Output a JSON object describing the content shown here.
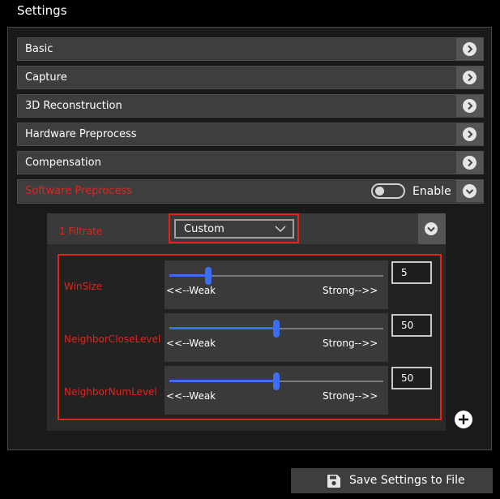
{
  "window": {
    "title": "Settings"
  },
  "sections": [
    {
      "label": "Basic"
    },
    {
      "label": "Capture"
    },
    {
      "label": "3D Reconstruction"
    },
    {
      "label": "Hardware Preprocess"
    },
    {
      "label": "Compensation"
    },
    {
      "label": "Software Preprocess"
    }
  ],
  "software_preprocess": {
    "enable_label": "Enable",
    "enable_on": false,
    "filter": {
      "name": "1  Filtrate",
      "mode": "Custom",
      "params": [
        {
          "label": "WinSize",
          "weak": "<<--Weak",
          "strong": "Strong-->>",
          "value": "5",
          "level": 0.18
        },
        {
          "label": "NeighborCloseLevel",
          "weak": "<<--Weak",
          "strong": "Strong-->>",
          "value": "50",
          "level": 0.5
        },
        {
          "label": "NeighborNumLevel",
          "weak": "<<--Weak",
          "strong": "Strong-->>",
          "value": "50",
          "level": 0.5
        }
      ]
    }
  },
  "actions": {
    "save_label": "Save Settings to File"
  },
  "colors": {
    "accent": "#3b6ef0",
    "highlight": "#e0251c",
    "background": "#000000"
  }
}
